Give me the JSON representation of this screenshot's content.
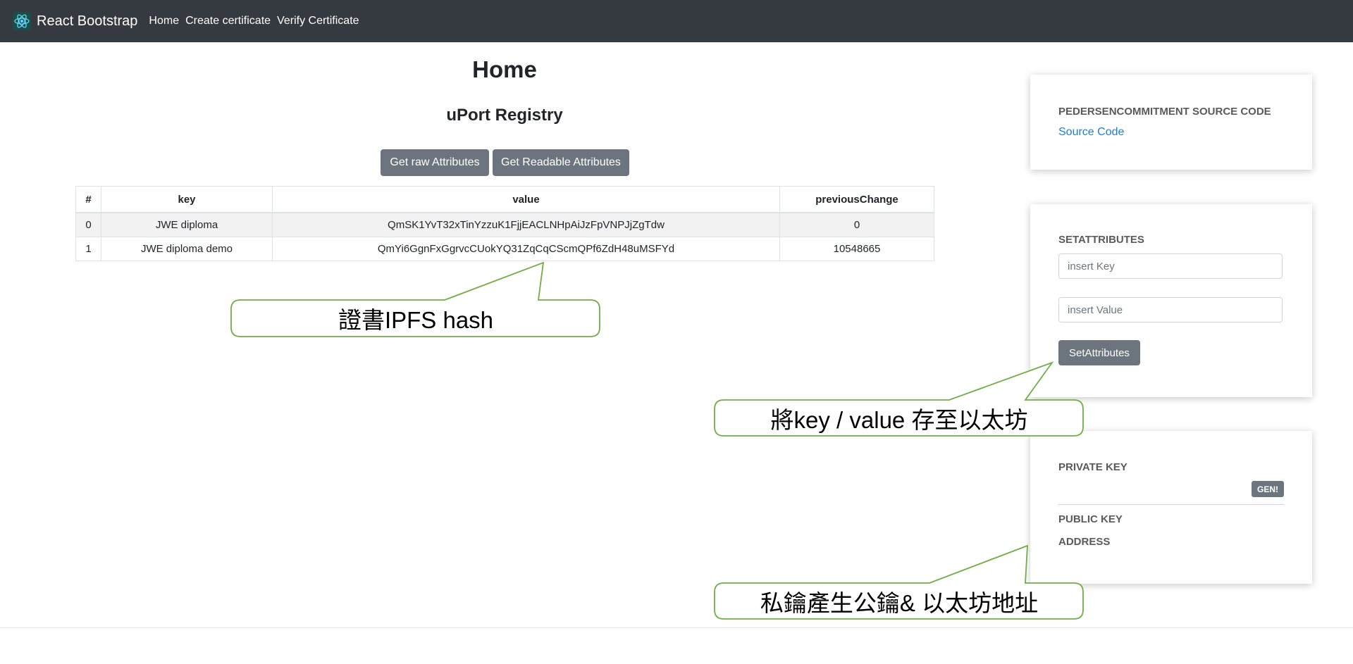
{
  "navbar": {
    "brand": "React Bootstrap",
    "links": [
      "Home",
      "Create certificate",
      "Verify Certificate"
    ],
    "bg_color": "#343a40"
  },
  "main": {
    "page_title": "Home",
    "registry_title": "uPort Registry",
    "buttons": {
      "raw": "Get raw Attributes",
      "readable": "Get Readable Attributes"
    },
    "table": {
      "headers": [
        "#",
        "key",
        "value",
        "previousChange"
      ],
      "rows": [
        [
          "0",
          "JWE diploma",
          "QmSK1YvT32xTinYzzuK1FjjEACLNHpAiJzFpVNPJjZgTdw",
          "0"
        ],
        [
          "1",
          "JWE diploma demo",
          "QmYi6GgnFxGgrvcCUokYQ31ZqCqCScmQPf6ZdH48uMSFYd",
          "10548665"
        ]
      ]
    }
  },
  "sidebar": {
    "source_card": {
      "heading": "PEDERSENCOMMITMENT SOURCE CODE",
      "link": "Source Code"
    },
    "set_card": {
      "heading": "SETATTRIBUTES",
      "key_placeholder": "insert Key",
      "value_placeholder": "insert Value",
      "button": "SetAttributes"
    },
    "key_card": {
      "private_key": "PRIVATE KEY",
      "gen_button": "GEN!",
      "public_key": "PUBLIC KEY",
      "address": "ADDRESS"
    }
  },
  "annotations": {
    "ipfs": "證書IPFS hash",
    "store": "將key / value 存至以太坊",
    "keys": "私鑰產生公鑰& 以太坊地址",
    "stroke_color": "#70ad47"
  },
  "colors": {
    "button_gray": "#6c757d",
    "link_blue": "#1f7bd6"
  }
}
